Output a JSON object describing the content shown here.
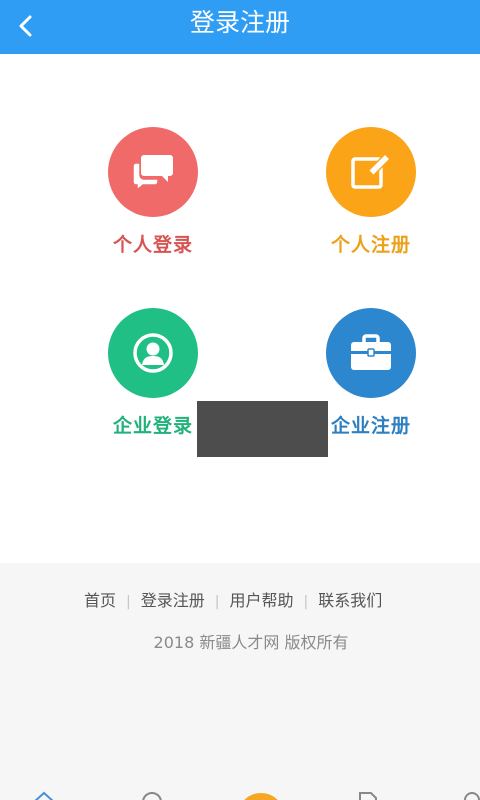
{
  "header": {
    "title": "登录注册",
    "back_icon": "chevron-left-icon",
    "background": "#2f9df4"
  },
  "tiles": [
    {
      "label": "个人登录",
      "icon": "chat-bubbles-icon",
      "color": "#f06a6a",
      "text_color": "#d65452"
    },
    {
      "label": "个人注册",
      "icon": "edit-note-icon",
      "color": "#fba418",
      "text_color": "#eca11b"
    },
    {
      "label": "企业登录",
      "icon": "user-circle-icon",
      "color": "#1fbf86",
      "text_color": "#21b17b"
    },
    {
      "label": "企业注册",
      "icon": "briefcase-icon",
      "color": "#2c87cf",
      "text_color": "#2d7fc0"
    }
  ],
  "footer": {
    "links": [
      "首页",
      "登录注册",
      "用户帮助",
      "联系我们"
    ],
    "separator": "|",
    "copyright": "2018 新疆人才网 版权所有"
  },
  "bottom_nav": {
    "icons": [
      "home-icon",
      "search-icon",
      "center-action-icon",
      "document-icon",
      "user-icon"
    ]
  }
}
